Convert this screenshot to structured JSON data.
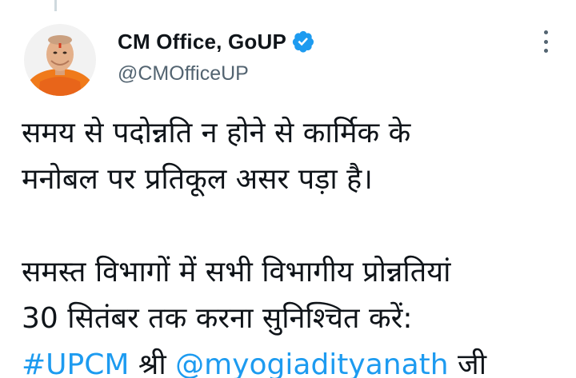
{
  "tweet": {
    "author": {
      "display_name": "CM Office, GoUP",
      "handle": "@CMOfficeUP",
      "verified": true,
      "avatar_icon": "profile-avatar"
    },
    "more_icon": "more-options-icon",
    "body": {
      "paragraph1": {
        "line1": "समय से पदोन्नति न होने से कार्मिक के",
        "line2": "मनोबल पर प्रतिकूल असर पड़ा है।"
      },
      "paragraph2": {
        "line1": "समस्त विभागों में सभी विभागीय प्रोन्नतियां",
        "line2": "30 सितंबर तक करना सुनिश्चित करें:",
        "line3": {
          "hashtag": "#UPCM",
          "shri": " श्री ",
          "mention": "@myogiadityanath",
          "ji": " जी"
        }
      }
    }
  },
  "colors": {
    "link": "#1d9bf0",
    "text": "#0f1419",
    "secondary": "#536471",
    "verified_badge": "#1d9bf0"
  }
}
